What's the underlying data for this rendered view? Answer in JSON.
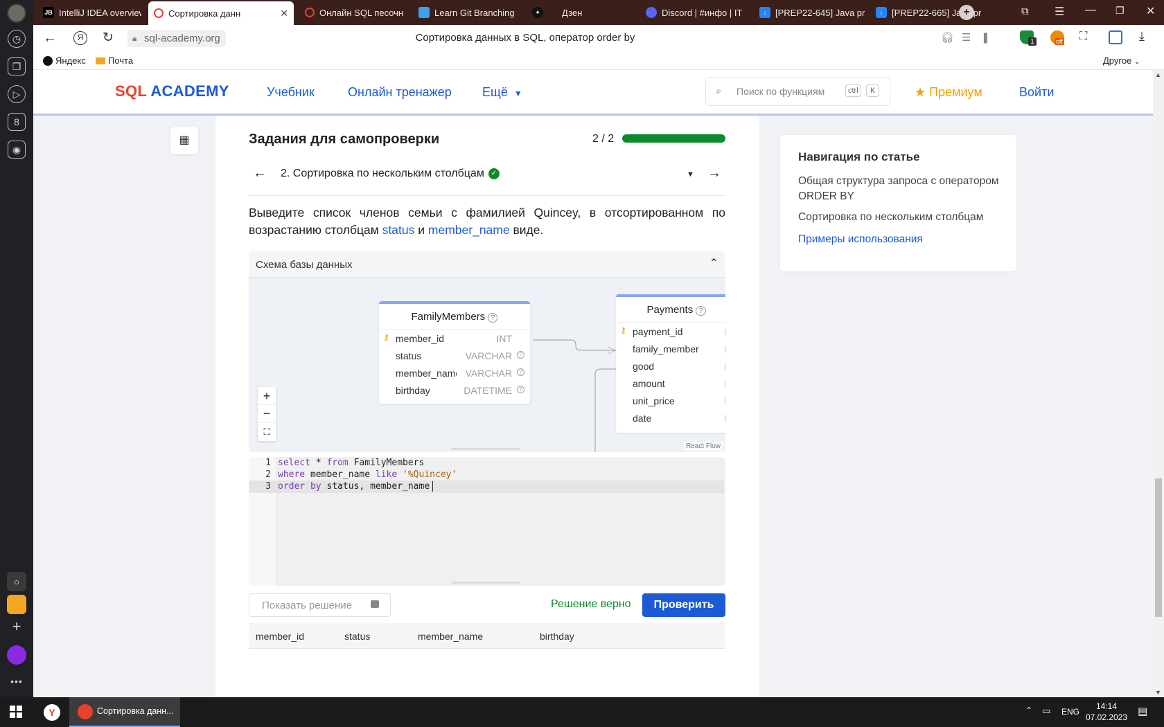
{
  "browser": {
    "tabs": [
      {
        "label": "IntelliJ IDEA overview",
        "icon": "jetbrains-icon"
      },
      {
        "label": "Сортировка данн",
        "icon": "sql-academy-icon",
        "active": true
      },
      {
        "label": "Онлайн SQL песочн",
        "icon": "sql-academy-icon"
      },
      {
        "label": "Learn Git Branching",
        "icon": "git-icon"
      },
      {
        "label": "Дзен",
        "icon": "dzen-icon"
      },
      {
        "label": "Discord | #инфо | IT",
        "icon": "discord-icon"
      },
      {
        "label": "[PREP22-645] Java pr",
        "icon": "jira-icon"
      },
      {
        "label": "[PREP22-665] Java pr",
        "icon": "jira-icon"
      }
    ],
    "url": "sql-academy.org",
    "page_title": "Сортировка данных в SQL, оператор order by",
    "bookmarks": [
      "Яндекс",
      "Почта"
    ],
    "bookmarks_other": "Другое",
    "extension_badge": "1",
    "extension_off": "off"
  },
  "site": {
    "logo_sql": "SQL",
    "logo_academy": "ACADEMY",
    "nav": [
      "Учебник",
      "Онлайн тренажер",
      "Ещё"
    ],
    "search_placeholder": "Поиск по функциям",
    "search_key_ctrl": "ctrl",
    "search_key_k": "K",
    "premium": "Премиум",
    "login": "Войти"
  },
  "task": {
    "heading": "Задания для самопроверки",
    "progress_text": "2 / 2",
    "progress": 1.0,
    "current": "2. Сортировка по нескольким столбцам",
    "desc_1": "Выведите список членов семьи с фамилией Quincey, в отсортированном по возрастанию столбцам",
    "desc_col1": "status",
    "desc_and": "и",
    "desc_col2": "member_name",
    "desc_end": "виде.",
    "schema_title": "Схема базы данных",
    "react_flow": "React Flow"
  },
  "schema": {
    "family": {
      "name": "FamilyMembers",
      "rows": [
        {
          "name": "member_id",
          "type": "INT",
          "key": true
        },
        {
          "name": "status",
          "type": "VARCHAR"
        },
        {
          "name": "member_name",
          "type": "VARCHAR"
        },
        {
          "name": "birthday",
          "type": "DATETIME"
        }
      ]
    },
    "payments": {
      "name": "Payments",
      "rows": [
        {
          "name": "payment_id",
          "type": "I",
          "key": true
        },
        {
          "name": "family_member",
          "type": "I"
        },
        {
          "name": "good",
          "type": "I"
        },
        {
          "name": "amount",
          "type": "I"
        },
        {
          "name": "unit_price",
          "type": "I"
        },
        {
          "name": "date",
          "type": "DATETI"
        }
      ]
    }
  },
  "editor": {
    "line_numbers": [
      "1",
      "2",
      "3"
    ],
    "l1": {
      "kw1": "select",
      "rest1": " * ",
      "kw2": "from",
      "rest2": " FamilyMembers"
    },
    "l2": {
      "kw1": "where",
      "rest1": " member_name ",
      "kw2": "like",
      "rest2": " ",
      "str": "'%Quincey'"
    },
    "l3": {
      "kw1": "order",
      "rest1": " ",
      "kw2": "by",
      "rest2": " status, member_name"
    }
  },
  "actions": {
    "show_solution": "Показать решение",
    "result_ok": "Решение верно",
    "check": "Проверить"
  },
  "result_columns": [
    "member_id",
    "status",
    "member_name",
    "birthday"
  ],
  "article_nav": {
    "title": "Навигация по статье",
    "items": [
      "Общая структура запроса с оператором ORDER BY",
      "Сортировка по нескольким столбцам",
      "Примеры использования"
    ]
  },
  "taskbar": {
    "app_label": "Сортировка данн...",
    "lang": "ENG",
    "time": "14:14",
    "date": "07.02.2023"
  },
  "colors": {
    "accent_blue": "#1d5bd6",
    "success_green": "#0d8a2c",
    "logo_red": "#e8412c",
    "premium_orange": "#f5a000"
  }
}
